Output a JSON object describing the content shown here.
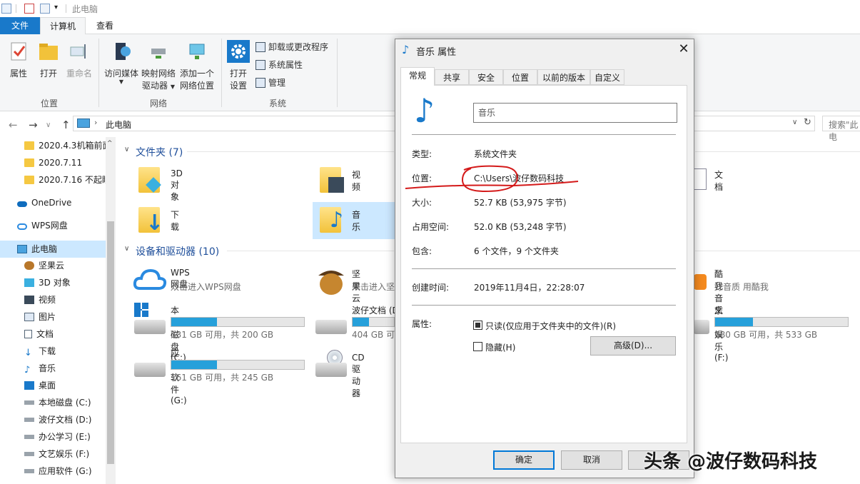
{
  "titlebar": {
    "path": "此电脑"
  },
  "ribbon_tabs": {
    "file": "文件",
    "computer": "计算机",
    "view": "查看"
  },
  "ribbon": {
    "location_group": {
      "label": "位置",
      "properties": "属性",
      "open": "打开",
      "rename": "重命名"
    },
    "network_group": {
      "label": "网络",
      "access_media": "访问媒体",
      "map_drive_1": "映射网络",
      "map_drive_2": "驱动器",
      "add_location_1": "添加一个",
      "add_location_2": "网络位置"
    },
    "system_group": {
      "label": "系统",
      "open_settings_1": "打开",
      "open_settings_2": "设置",
      "uninstall": "卸载或更改程序",
      "system_properties": "系统属性",
      "manage": "管理"
    }
  },
  "address": {
    "current": "此电脑",
    "search_placeholder": "搜索\"此电"
  },
  "sidebar": {
    "items": [
      {
        "label": "2020.4.3机箱前面"
      },
      {
        "label": "2020.7.11"
      },
      {
        "label": "2020.7.16 不起眼"
      },
      {
        "label": "OneDrive"
      },
      {
        "label": "WPS网盘"
      },
      {
        "label": "此电脑"
      },
      {
        "label": "坚果云"
      },
      {
        "label": "3D 对象"
      },
      {
        "label": "视频"
      },
      {
        "label": "图片"
      },
      {
        "label": "文档"
      },
      {
        "label": "下载"
      },
      {
        "label": "音乐"
      },
      {
        "label": "桌面"
      },
      {
        "label": "本地磁盘 (C:)"
      },
      {
        "label": "波仔文档 (D:)"
      },
      {
        "label": "办公学习 (E:)"
      },
      {
        "label": "文艺娱乐 (F:)"
      },
      {
        "label": "应用软件 (G:)"
      }
    ]
  },
  "main": {
    "folders_header": "文件夹 (7)",
    "folders": [
      {
        "name": "3D 对象"
      },
      {
        "name": "视频"
      },
      {
        "name": "文档"
      },
      {
        "name": "下载"
      },
      {
        "name": "音乐"
      }
    ],
    "devices_header": "设备和驱动器 (10)",
    "devices": [
      {
        "name": "WPS网盘",
        "sub": "双击进入WPS网盘"
      },
      {
        "name": "坚果云",
        "sub": "双击进入坚"
      },
      {
        "name": "酷我音乐",
        "sub": "好音质 用酷我"
      },
      {
        "name": "本地磁盘 (C:)",
        "sub": "131 GB 可用，共 200 GB",
        "used_fraction": 0.345
      },
      {
        "name": "波仔文档 (D",
        "sub": "404 GB 可",
        "used_fraction": 0.4
      },
      {
        "name": "文艺娱乐 (F:)",
        "sub": "380 GB 可用，共 533 GB",
        "used_fraction": 0.287
      },
      {
        "name": "应用软件 (G:)",
        "sub": "161 GB 可用，共 245 GB",
        "used_fraction": 0.343
      },
      {
        "name": "CD 驱动器"
      }
    ]
  },
  "dialog": {
    "title": "音乐 属性",
    "tabs": [
      "常规",
      "共享",
      "安全",
      "位置",
      "以前的版本",
      "自定义"
    ],
    "name_value": "音乐",
    "type_label": "类型:",
    "type_value": "系统文件夹",
    "location_label": "位置:",
    "location_value": "C:\\Users\\波仔数码科技",
    "size_label": "大小:",
    "size_value": "52.7 KB (53,975 字节)",
    "disk_size_label": "占用空间:",
    "disk_size_value": "52.0 KB (53,248 字节)",
    "contains_label": "包含:",
    "contains_value": "6 个文件，9 个文件夹",
    "created_label": "创建时间:",
    "created_value": "2019年11月4日，22:28:07",
    "attributes_label": "属性:",
    "readonly_label": "只读(仅应用于文件夹中的文件)(R)",
    "hidden_label": "隐藏(H)",
    "advanced_button": "高级(D)...",
    "ok_button": "确定",
    "cancel_button": "取消"
  },
  "watermark": "头条 @波仔数码科技"
}
